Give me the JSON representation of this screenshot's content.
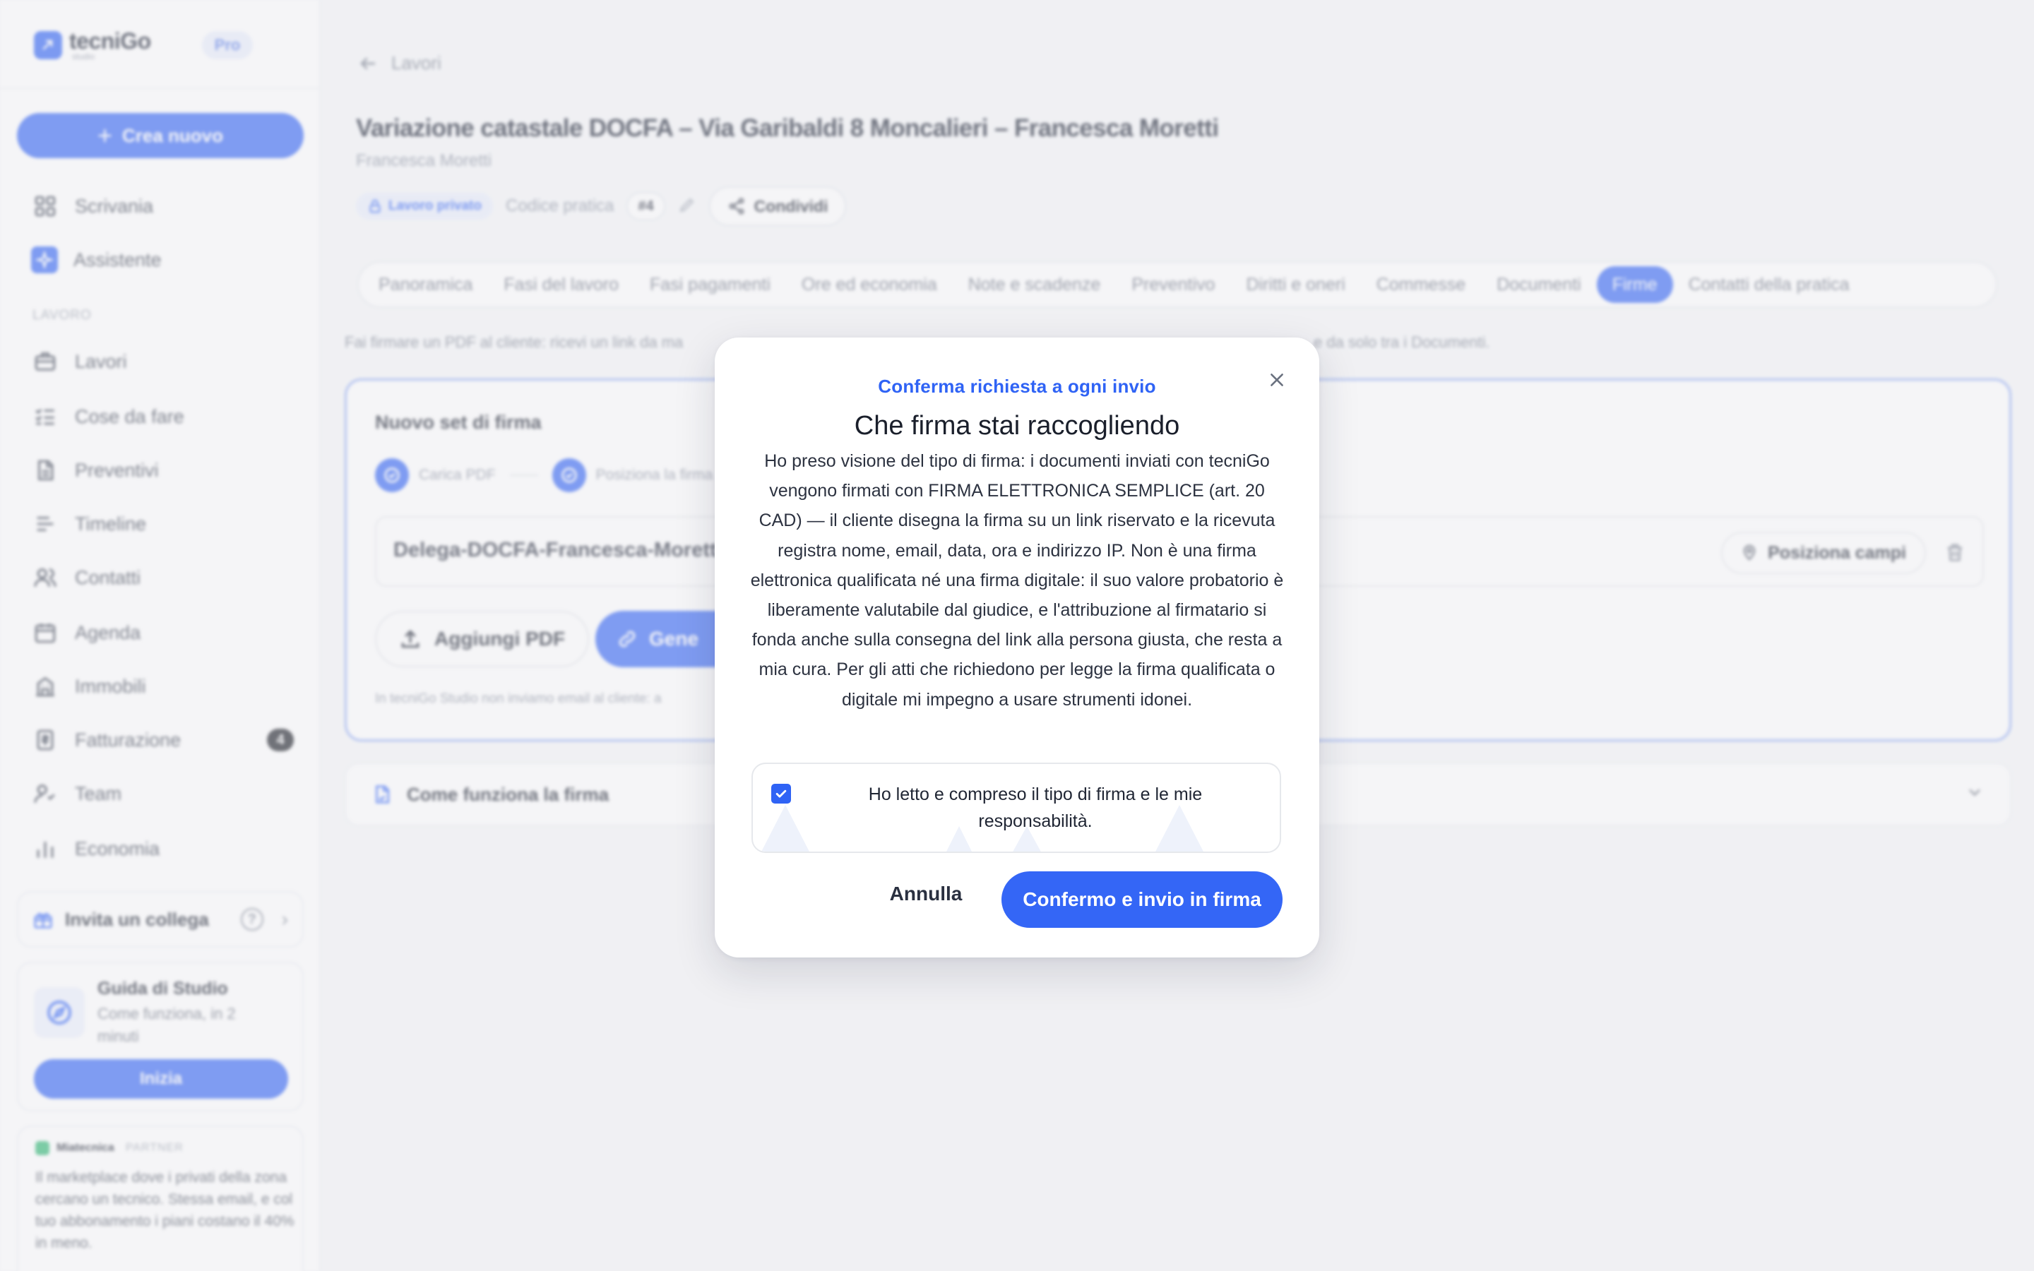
{
  "sidebar": {
    "brand_name": "tecniGo",
    "brand_sub": "studio",
    "plan_badge": "Pro",
    "create_label": "Crea nuovo",
    "items_top": [
      {
        "label": "Scrivania",
        "icon": "dashboard-icon"
      },
      {
        "label": "Assistente",
        "icon": "assistant-icon"
      }
    ],
    "section_label": "LAVORO",
    "items": [
      {
        "label": "Lavori",
        "icon": "briefcase-icon"
      },
      {
        "label": "Cose da fare",
        "icon": "checklist-icon"
      },
      {
        "label": "Preventivi",
        "icon": "document-icon"
      },
      {
        "label": "Timeline",
        "icon": "timeline-icon"
      },
      {
        "label": "Contatti",
        "icon": "contacts-icon"
      },
      {
        "label": "Agenda",
        "icon": "calendar-icon"
      },
      {
        "label": "Immobili",
        "icon": "building-icon"
      },
      {
        "label": "Fatturazione",
        "icon": "invoice-icon",
        "count": "4"
      },
      {
        "label": "Team",
        "icon": "team-icon"
      },
      {
        "label": "Economia",
        "icon": "chart-icon"
      }
    ],
    "invite_label": "Invita un collega",
    "guide": {
      "title": "Guida di Studio",
      "subtitle": "Come funziona, in 2 minuti",
      "button": "Inizia"
    },
    "partner": {
      "name": "Miatecnica",
      "tag": "PARTNER",
      "text": "Il marketplace dove i privati della zona cercano un tecnico. Stessa email, e col tuo abbonamento i piani costano il 40% in meno."
    }
  },
  "main": {
    "back_label": "Lavori",
    "title": "Variazione catastale DOCFA – Via Garibaldi 8 Moncalieri – Francesca Moretti",
    "subtitle": "Francesca Moretti",
    "private_badge": "Lavoro privato",
    "code_label": "Codice pratica",
    "code_value": "#4",
    "share_label": "Condividi",
    "tabs": [
      "Panoramica",
      "Fasi del lavoro",
      "Fasi pagamenti",
      "Ore ed economia",
      "Note e scadenze",
      "Preventivo",
      "Diritti e oneri",
      "Commesse",
      "Documenti",
      "Firme",
      "Contatti della pratica"
    ],
    "active_tab": "Firme",
    "hint_start": "Fai firmare un PDF al cliente: ricevi un link da ma",
    "hint_end": "e da solo tra i Documenti.",
    "signature_set": {
      "title": "Nuovo set di firma",
      "step1": "Carica PDF",
      "step2": "Posiziona la firma",
      "file_name": "Delega-DOCFA-Francesca-Moretti",
      "place_fields": "Posiziona campi",
      "add_pdf": "Aggiungi PDF",
      "generate": "Gene",
      "note": "In tecniGo Studio non inviamo email al cliente: a"
    },
    "how_it_works": "Come funziona la firma"
  },
  "modal": {
    "eyebrow": "Conferma richiesta a ogni invio",
    "title": "Che firma stai raccogliendo",
    "body": "Ho preso visione del tipo di firma: i documenti inviati con tecniGo vengono firmati con FIRMA ELETTRONICA SEMPLICE (art. 20 CAD) — il cliente disegna la firma su un link riservato e la ricevuta registra nome, email, data, ora e indirizzo IP. Non è una firma elettronica qualificata né una firma digitale: il suo valore probatorio è liberamente valutabile dal giudice, e l'attribuzione al firmatario si fonda anche sulla consegna del link alla persona giusta, che resta a mia cura. Per gli atti che richiedono per legge la firma qualificata o digitale mi impegno a usare strumenti idonei.",
    "ack_label": "Ho letto e compreso il tipo di firma e le mie responsabilità.",
    "ack_checked": true,
    "cancel_label": "Annulla",
    "confirm_label": "Confermo e invio in firma"
  },
  "colors": {
    "accent": "#3466f6",
    "text": "#1c2230",
    "muted": "#8a91a0"
  }
}
